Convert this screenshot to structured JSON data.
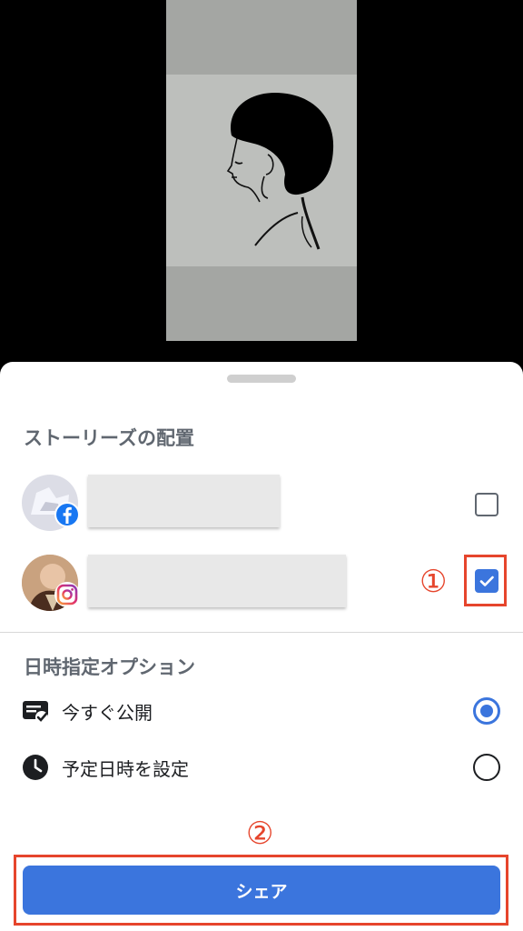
{
  "placement": {
    "title": "ストーリーズの配置",
    "accounts": [
      {
        "platform": "facebook",
        "badge_icon": "facebook-icon",
        "checked": false
      },
      {
        "platform": "instagram",
        "badge_icon": "instagram-icon",
        "checked": true
      }
    ]
  },
  "schedule": {
    "title": "日時指定オプション",
    "options": [
      {
        "label": "今すぐ公開",
        "icon": "publish-now-icon",
        "selected": true
      },
      {
        "label": "予定日時を設定",
        "icon": "clock-icon",
        "selected": false
      }
    ]
  },
  "annotations": {
    "step1": "①",
    "step2": "②"
  },
  "share_button": {
    "label": "シェア"
  },
  "colors": {
    "accent": "#3b75dd",
    "annotation": "#e6452c",
    "facebook": "#1877f2"
  }
}
